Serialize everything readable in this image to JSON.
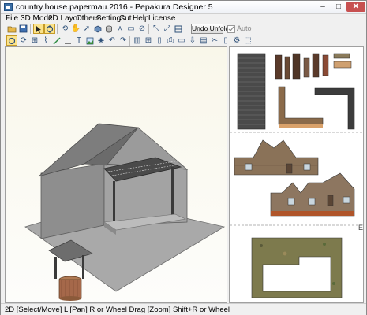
{
  "window": {
    "title": "country.house.papermau.2016 - Pepakura Designer 5",
    "min_glyph": "–",
    "max_glyph": "□",
    "close_glyph": "✕"
  },
  "menu": [
    "File",
    "3D Model",
    "2D Layout",
    "Others",
    "Settings",
    "Cut",
    "Help",
    "License"
  ],
  "toolbar": {
    "undo_unfold_label": "Undo Unfold",
    "auto_label": "Auto",
    "auto_checked": true,
    "row1_icons": [
      "open-icon",
      "save-icon",
      "select-icon",
      "pan-icon",
      "rotate-icon",
      "select-flap-icon",
      "hand-icon",
      "arrow-icon",
      "cube-icon",
      "cylinder-icon",
      "edge-icon",
      "face-icon",
      "join-icon",
      "texture-icon",
      "zoom-icon",
      "zoom-out-icon",
      "fit-icon",
      "clip-icon",
      "split-view-icon",
      "single-view-icon"
    ],
    "row2_icons": [
      "select-mode-icon",
      "rotate-part-icon",
      "join-part-icon",
      "edit-edge-icon",
      "flap-icon",
      "line-icon",
      "text-icon",
      "image-icon",
      "move-icon",
      "undo-icon",
      "redo-icon",
      "layout-icon",
      "grid-icon",
      "page-icon",
      "print-icon",
      "page-setup-icon",
      "export-icon",
      "pdf-icon",
      "cut-icon",
      "paper-icon",
      "settings-icon",
      "fit-page-icon"
    ]
  },
  "status": {
    "text": "2D [Select/Move] L [Pan] R or Wheel Drag [Zoom] Shift+R or Wheel"
  },
  "view2d": {
    "page_marker": "E"
  },
  "colors": {
    "accent_active": "#fbe38b",
    "viewport_bg_top": "#f6f3e3",
    "house_wall": "#9d9d9d",
    "roof": "#7a7a7a",
    "wood": "#a1835f"
  }
}
